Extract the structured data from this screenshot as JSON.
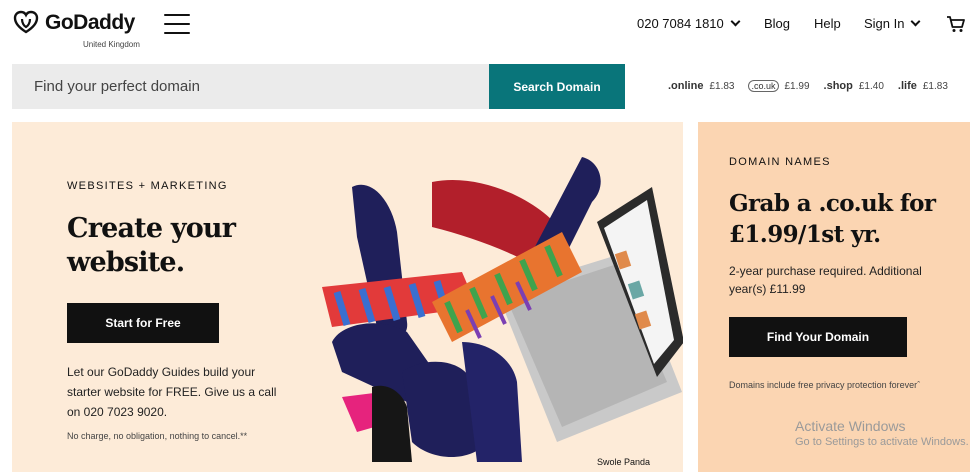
{
  "header": {
    "logo_text": "GoDaddy",
    "logo_sub": "United Kingdom",
    "phone": "020 7084 1810",
    "blog": "Blog",
    "help": "Help",
    "sign_in": "Sign In"
  },
  "search": {
    "placeholder": "Find your perfect domain",
    "button": "Search Domain"
  },
  "tlds": [
    {
      "name": ".online",
      "price": "£1.83"
    },
    {
      "name": ".co.uk",
      "price": "£1.99"
    },
    {
      "name": ".shop",
      "price": "£1.40"
    },
    {
      "name": ".life",
      "price": "£1.83"
    }
  ],
  "hero": {
    "eyebrow": "WEBSITES + MARKETING",
    "title_line1": "Create your",
    "title_line2": "website.",
    "button": "Start for Free",
    "description": "Let our GoDaddy Guides build your starter website for FREE. Give us a call on 020 7023 9020.",
    "fine_print": "No charge, no obligation, nothing to cancel.**",
    "image_caption": "Swole Panda"
  },
  "domain_card": {
    "eyebrow": "DOMAIN NAMES",
    "title": "Grab a .co.uk for £1.99/1st yr.",
    "description": "2-year purchase required. Additional year(s) £11.99",
    "button": "Find Your Domain",
    "fine_print": "Domains include free privacy protection foreverˆ"
  },
  "watermark": {
    "line1": "Activate Windows",
    "line2": "Go to Settings to activate Windows."
  },
  "colors": {
    "accent_teal": "#09757a",
    "hero_bg": "#fdebd8",
    "domain_bg": "#fbd5b2"
  },
  "icons": [
    "godaddy-logo-icon",
    "hamburger-menu-icon",
    "chevron-down-icon",
    "cart-icon"
  ]
}
